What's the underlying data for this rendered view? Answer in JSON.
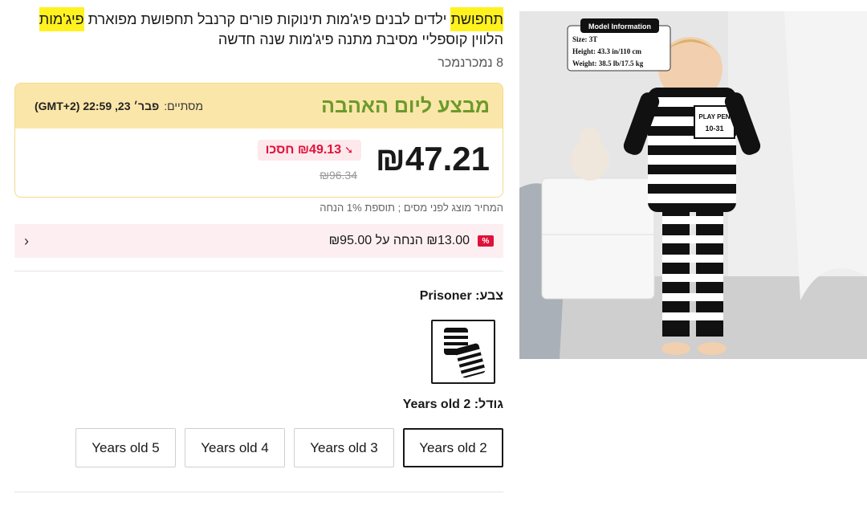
{
  "product": {
    "title_highlight_1": "תחפושת",
    "title_middle": " ילדים לבנים פיג'מות תינוקות פורים קרנבל תחפושת מפוארת ",
    "title_highlight_2": "פיג'מות",
    "title_rest": " הלווין קוספליי מסיבת מתנה פיג'מות שנה חדשה",
    "sold_count": "8 נמכרנמכר"
  },
  "deal": {
    "title": "מבצע ליום האהבה",
    "ends_label": "מסתיים:",
    "ends_time": "פבר׳ 23, 22:59 (GMT+2)",
    "price_now": "₪47.21",
    "save_label": "₪49.13 חסכו",
    "price_old": "₪96.34"
  },
  "tax_note": "המחיר מוצג לפני מסים ; תוספת 1% הנחה",
  "coupon": {
    "badge": "%",
    "text": "₪13.00 הנחה על ₪95.00"
  },
  "color": {
    "label": "צבע: Prisoner"
  },
  "size": {
    "label": "גודל: Years old 2",
    "options": [
      "Years old 2",
      "Years old 3",
      "Years old 4",
      "Years old 5"
    ],
    "selected": "Years old 2"
  },
  "image": {
    "info_title": "Model Information",
    "info_size": "Size: 3T",
    "info_height": "Height:  43.3 in/110 cm",
    "info_weight": "Weight:  38.5 lb/17.5 kg",
    "shirt_line1": "PLAY PEN",
    "shirt_line2": "10-31"
  },
  "colors": {
    "deal_bg": "#fbe6a9",
    "deal_title": "#6b9a2b",
    "save_red": "#e0113a",
    "coupon_bg": "#fdeff1",
    "highlight": "#fff21f"
  }
}
